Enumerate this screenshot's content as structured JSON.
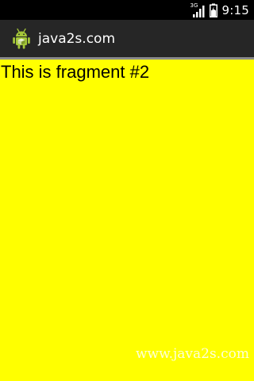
{
  "status_bar": {
    "network_type": "3G",
    "time": "9:15",
    "icons": [
      "signal-icon",
      "battery-icon"
    ]
  },
  "action_bar": {
    "title": "java2s.com",
    "logo_icon": "android-logo-icon"
  },
  "content": {
    "fragment_text": "This is fragment #2",
    "background_color": "#ffff00",
    "watermark": "www.java2s.com"
  }
}
